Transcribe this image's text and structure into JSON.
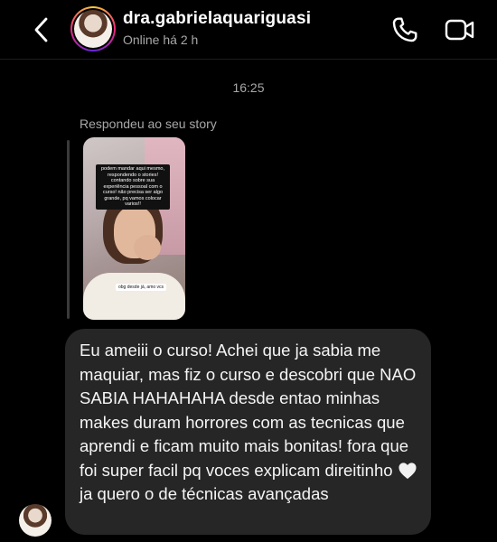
{
  "header": {
    "username": "dra.gabrielaquariguasi",
    "status": "Online há 2 h",
    "icons": {
      "back": "chevron-left-icon",
      "call": "phone-icon",
      "video": "video-camera-icon"
    }
  },
  "conversation": {
    "timestamp": "16:25",
    "story_reply": {
      "label": "Respondeu ao seu story",
      "story_caption": "podem mandar aqui mesmo, respondendo o stories! contando sobre sua experiência pessoal com o curso! não precisa ser algo grande, pq vamos colocar varios!!",
      "story_sticker": "obg desde já, amo vcs"
    },
    "message": {
      "text_before_emoji": "Eu ameiii o curso! Achei que ja sabia me maquiar, mas fiz o curso e descobri que NAO SABIA HAHAHAHA desde entao minhas makes duram horrores com as tecnicas que aprendi e ficam muito mais bonitas! fora que foi super facil pq voces explicam direitinho",
      "emoji": "white-heart-icon",
      "text_after_emoji": "ja quero o de técnicas avançadas"
    }
  },
  "colors": {
    "background": "#000000",
    "bubble": "#262626",
    "secondary_text": "#a8a8a8"
  }
}
